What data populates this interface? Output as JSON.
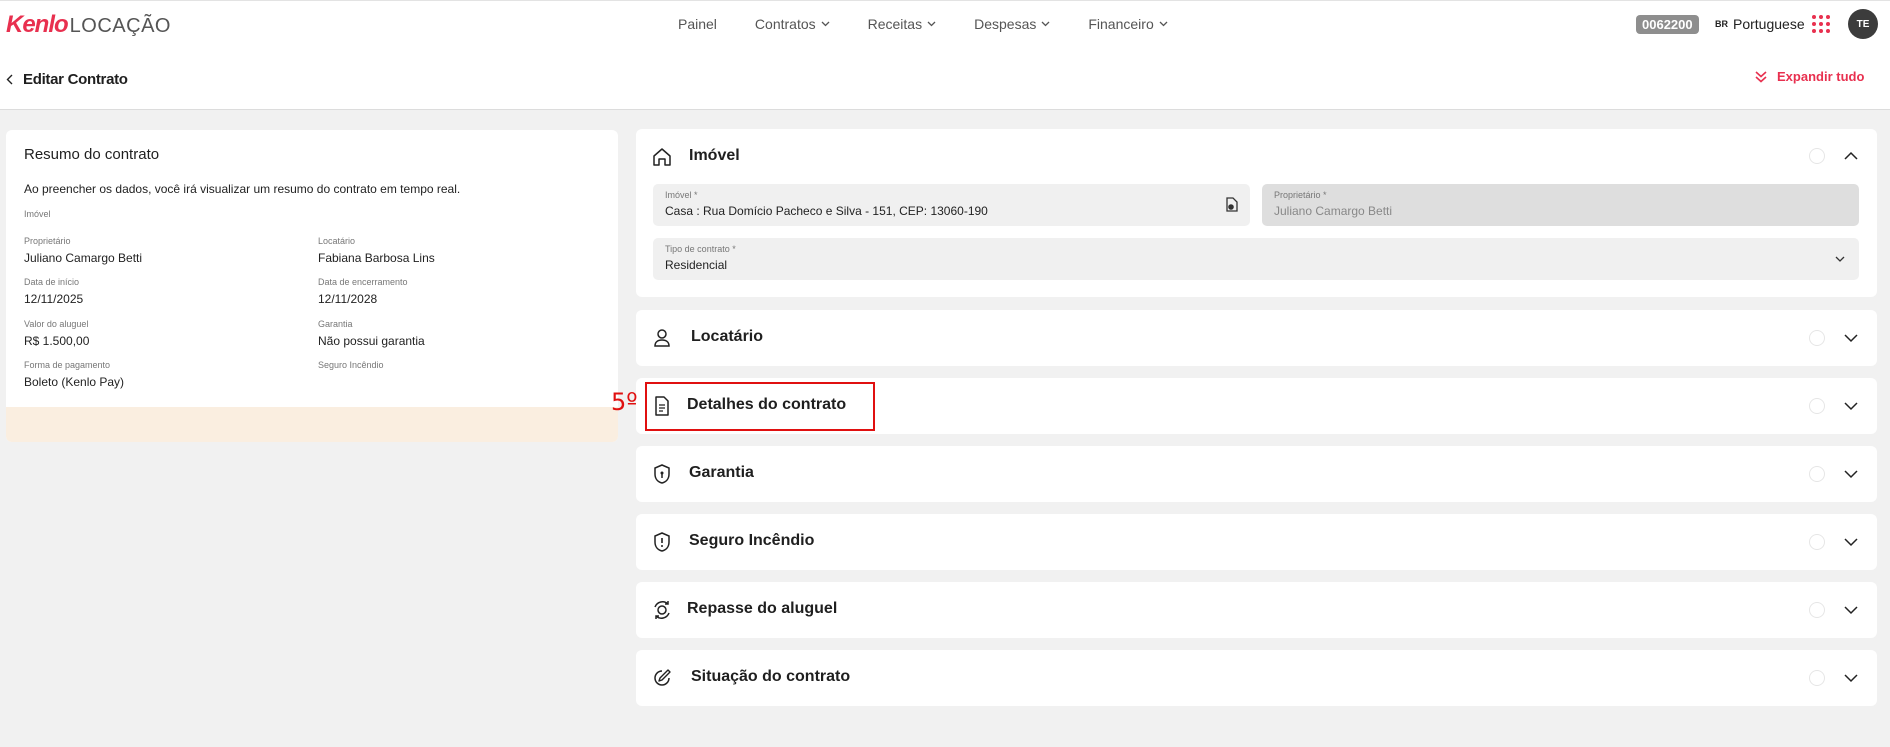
{
  "header": {
    "logo_brand": "Kenlo",
    "logo_product": "LOCAÇÃO",
    "nav": [
      "Painel",
      "Contratos",
      "Receitas",
      "Despesas",
      "Financeiro"
    ],
    "code": "0062200",
    "language_flag": "BR",
    "language": "Portuguese",
    "avatar_initials": "TE"
  },
  "subheader": {
    "title": "Editar Contrato",
    "expand_label": "Expandir tudo"
  },
  "summary": {
    "title": "Resumo do contrato",
    "intro": "Ao preencher os dados, você irá visualizar um resumo do contrato em tempo real.",
    "section_label": "Imóvel",
    "owner_label": "Proprietário",
    "owner": "Juliano Camargo Betti",
    "tenant_label": "Locatário",
    "tenant": "Fabiana Barbosa Lins",
    "start_label": "Data de início",
    "start": "12/11/2025",
    "end_label": "Data de encerramento",
    "end": "12/11/2028",
    "rent_label": "Valor do aluguel",
    "rent": "R$ 1.500,00",
    "guarantee_label": "Garantia",
    "guarantee": "Não possui garantia",
    "payment_label": "Forma de pagamento",
    "payment": "Boleto (Kenlo Pay)",
    "insurance_label": "Seguro Incêndio"
  },
  "imovel": {
    "title": "Imóvel",
    "property_label": "Imóvel *",
    "property_value": "Casa : Rua Domício Pacheco e Silva - 151, CEP: 13060-190",
    "owner_label": "Proprietário *",
    "owner_value": "Juliano Camargo Betti",
    "contract_type_label": "Tipo de contrato *",
    "contract_type_value": "Residencial"
  },
  "sections": {
    "locatario": "Locatário",
    "detalhes": "Detalhes do contrato",
    "garantia": "Garantia",
    "seguro": "Seguro Incêndio",
    "repasse": "Repasse do aluguel",
    "situacao": "Situação do contrato"
  },
  "annotation": "5º",
  "colors": {
    "accent": "#e8304f",
    "annotation": "#e01010"
  }
}
